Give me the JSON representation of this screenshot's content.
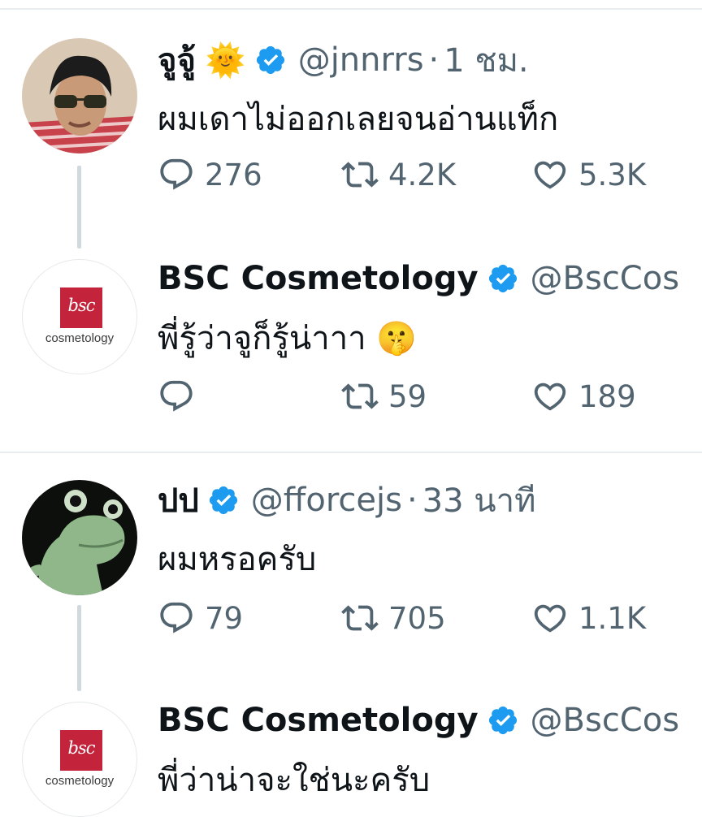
{
  "colors": {
    "verified": "#1d9bf0",
    "muted": "#536471",
    "text": "#0f1419",
    "brand_red": "#c4243b"
  },
  "tweets": [
    {
      "name": "จูจู้",
      "name_emoji": "🌞",
      "handle": "@jnnrrs",
      "dot": "·",
      "time": "1 ชม.",
      "text": "ผมเดาไม่ออกเลยจนอ่านแท็ก",
      "replies": "276",
      "retweets": "4.2K",
      "likes": "5.3K"
    },
    {
      "name": "BSC Cosmetology",
      "handle": "@BscCos",
      "text": "พี่รู้ว่าจูก็รู้น่าาา 🤫",
      "replies": "",
      "retweets": "59",
      "likes": "189",
      "avatar_logo": "bsc",
      "avatar_caption": "cosmetology"
    },
    {
      "name": "ปป",
      "handle": "@fforcejs",
      "dot": "·",
      "time": "33 นาที",
      "text": "ผมหรอครับ",
      "replies": "79",
      "retweets": "705",
      "likes": "1.1K"
    },
    {
      "name": "BSC Cosmetology",
      "handle": "@BscCos",
      "text": "พี่ว่าน่าจะใช่นะครับ",
      "avatar_logo": "bsc",
      "avatar_caption": "cosmetology"
    }
  ]
}
